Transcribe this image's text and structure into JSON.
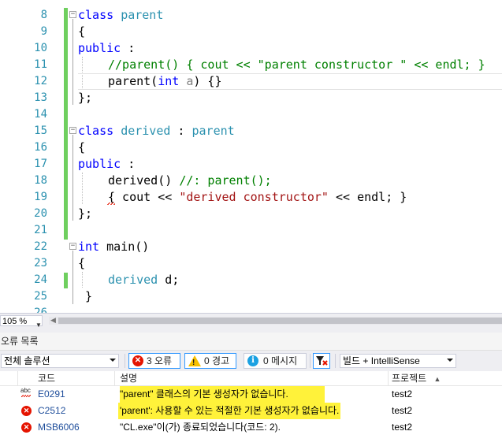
{
  "editor": {
    "lines": [
      {
        "num": "8"
      },
      {
        "num": "9"
      },
      {
        "num": "10"
      },
      {
        "num": "11"
      },
      {
        "num": "12"
      },
      {
        "num": "13"
      },
      {
        "num": "14"
      },
      {
        "num": "15"
      },
      {
        "num": "16"
      },
      {
        "num": "17"
      },
      {
        "num": "18"
      },
      {
        "num": "19"
      },
      {
        "num": "20"
      },
      {
        "num": "21"
      },
      {
        "num": "22"
      },
      {
        "num": "23"
      },
      {
        "num": "24"
      },
      {
        "num": "25"
      },
      {
        "num": "26"
      }
    ],
    "code": {
      "l8_kw": "class",
      "l8_name": "parent",
      "l9": "{",
      "l10_kw": "public",
      "l10_rest": " :",
      "l11": "//parent() { cout << \"parent constructor \" << endl; }",
      "l12_a": "parent(",
      "l12_kw": "int",
      "l12_sp": " ",
      "l12_param": "a",
      "l12_b": ") {}",
      "l13": "};",
      "l15_kw": "class",
      "l15_name": "derived",
      "l15_colon": " : ",
      "l15_base": "parent",
      "l16": "{",
      "l17_kw": "public",
      "l17_rest": " :",
      "l18_a": "derived() ",
      "l18_cm": "//: parent();",
      "l19_a": "{ cout << ",
      "l19_str": "\"derived constructor\"",
      "l19_b": " << endl; }",
      "l20": "};",
      "l22_kw": "int",
      "l22_rest": " main()",
      "l23": "{",
      "l24_ty": "derived",
      "l24_rest": " d;",
      "l25": "}"
    }
  },
  "zoom": "105 %",
  "error_panel": {
    "title": "오류 목록",
    "scope": "전체 솔루션",
    "errors_btn": "3 오류",
    "warnings_btn": "0 경고",
    "messages_btn": "0 메시지",
    "build_filter": "빌드 + IntelliSense",
    "columns": {
      "code": "코드",
      "desc": "설명",
      "project": "프로젝트"
    },
    "rows": [
      {
        "code": "E0291",
        "desc": "\"parent\" 클래스의 기본 생성자가 없습니다.",
        "project": "test2",
        "icon": "intellisense-error-icon"
      },
      {
        "code": "C2512",
        "desc": "'parent': 사용할 수 있는 적절한 기본 생성자가 없습니다.",
        "project": "test2",
        "icon": "error-icon"
      },
      {
        "code": "MSB6006",
        "desc": "\"CL.exe\"이(가) 종료되었습니다(코드: 2).",
        "project": "test2",
        "icon": "error-icon"
      }
    ]
  },
  "colors": {
    "keyword": "#0000ff",
    "type": "#2b91af",
    "comment": "#008000",
    "string": "#a31515",
    "change_bar": "#6fcf5f",
    "highlight": "#fff23a",
    "error": "#e51400"
  }
}
